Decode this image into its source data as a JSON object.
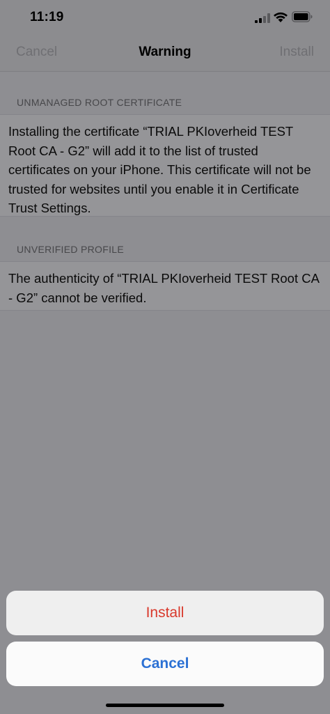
{
  "status_bar": {
    "time": "11:19",
    "icons": [
      "signal-icon",
      "wifi-icon",
      "battery-icon"
    ]
  },
  "nav": {
    "cancel_label": "Cancel",
    "title": "Warning",
    "install_label": "Install"
  },
  "sections": [
    {
      "header": "UNMANAGED ROOT CERTIFICATE",
      "body": "Installing the certificate “TRIAL PKIoverheid TEST Root CA - G2” will add it to the list of trusted certificates on your iPhone. This certificate will not be trusted for websites until you enable it in Certificate Trust Settings."
    },
    {
      "header": "UNVERIFIED PROFILE",
      "body": "The authenticity of “TRIAL PKIoverheid TEST Root CA - G2” cannot be verified."
    }
  ],
  "action_sheet": {
    "install_label": "Install",
    "cancel_label": "Cancel",
    "install_color": "#d9392c",
    "cancel_color": "#2c71d4"
  }
}
